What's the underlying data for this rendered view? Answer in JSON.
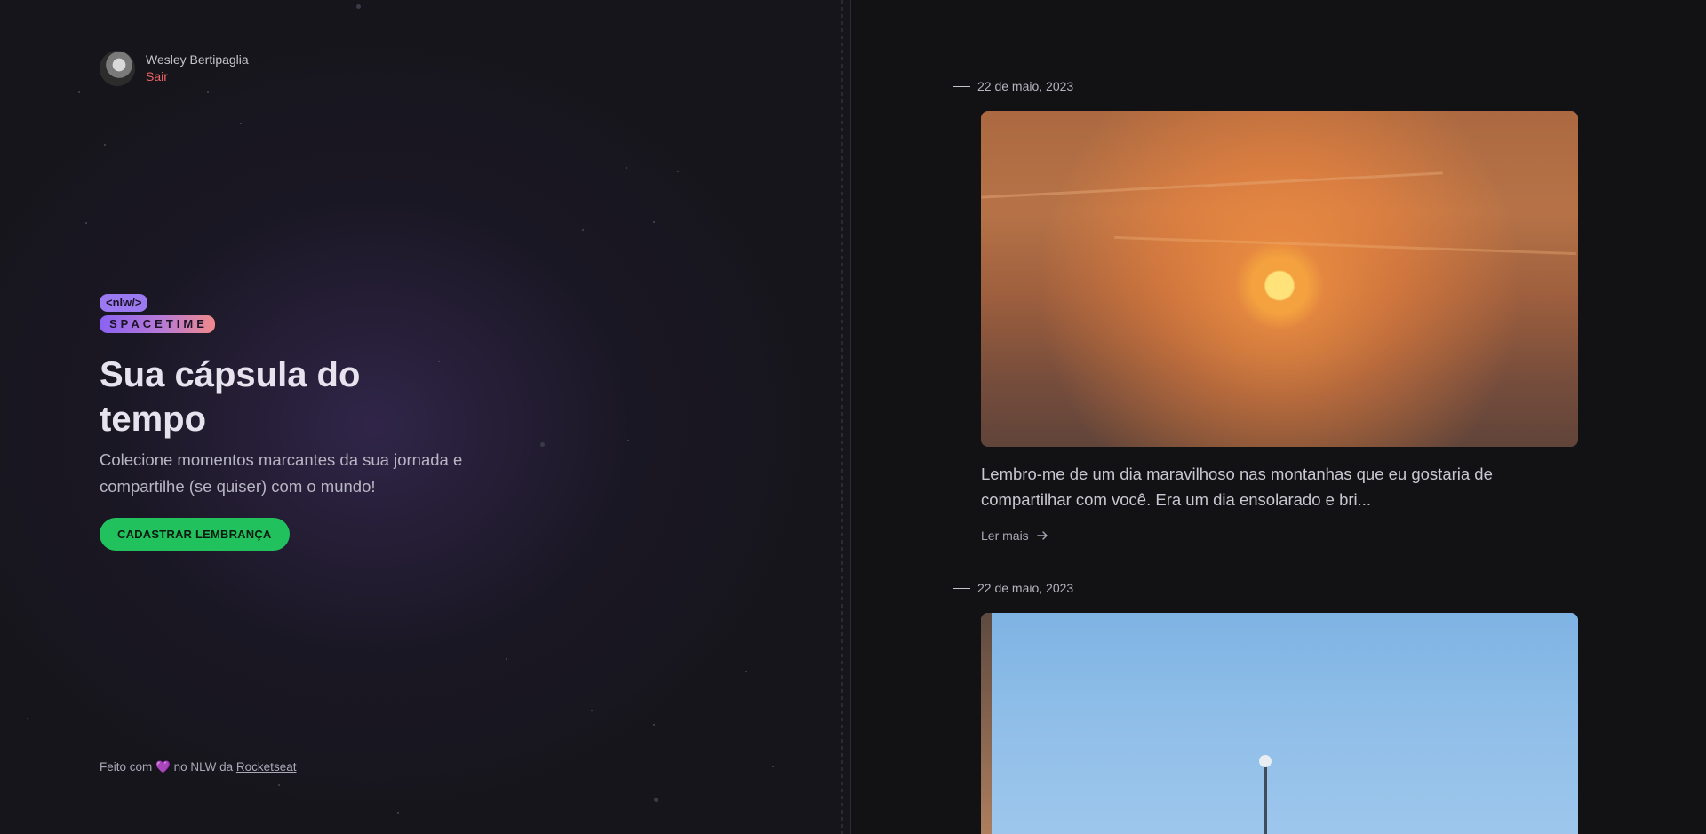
{
  "user": {
    "name": "Wesley Bertipaglia",
    "logout_label": "Sair"
  },
  "logo": {
    "tag": "<nlw/>",
    "word": "SPACETIME"
  },
  "hero": {
    "title": "Sua cápsula do tempo",
    "subtitle": "Colecione momentos marcantes da sua jornada e compartilhe (se quiser) com o mundo!",
    "cta_label": "CADASTRAR LEMBRANÇA"
  },
  "footer": {
    "prefix": "Feito com",
    "heart": "💜",
    "middle": "no NLW da",
    "link": "Rocketseat"
  },
  "memories": [
    {
      "date": "22 de maio, 2023",
      "excerpt": "Lembro-me de um dia maravilhoso nas montanhas que eu gostaria de compartilhar com você. Era um dia ensolarado e bri...",
      "read_more": "Ler mais",
      "read_more_icon": "arrow-right-icon"
    },
    {
      "date": "22 de maio, 2023"
    }
  ],
  "colors": {
    "accent_green": "#21c25e",
    "logout_red": "#f06464",
    "brand_purple": "#9b79f0"
  }
}
